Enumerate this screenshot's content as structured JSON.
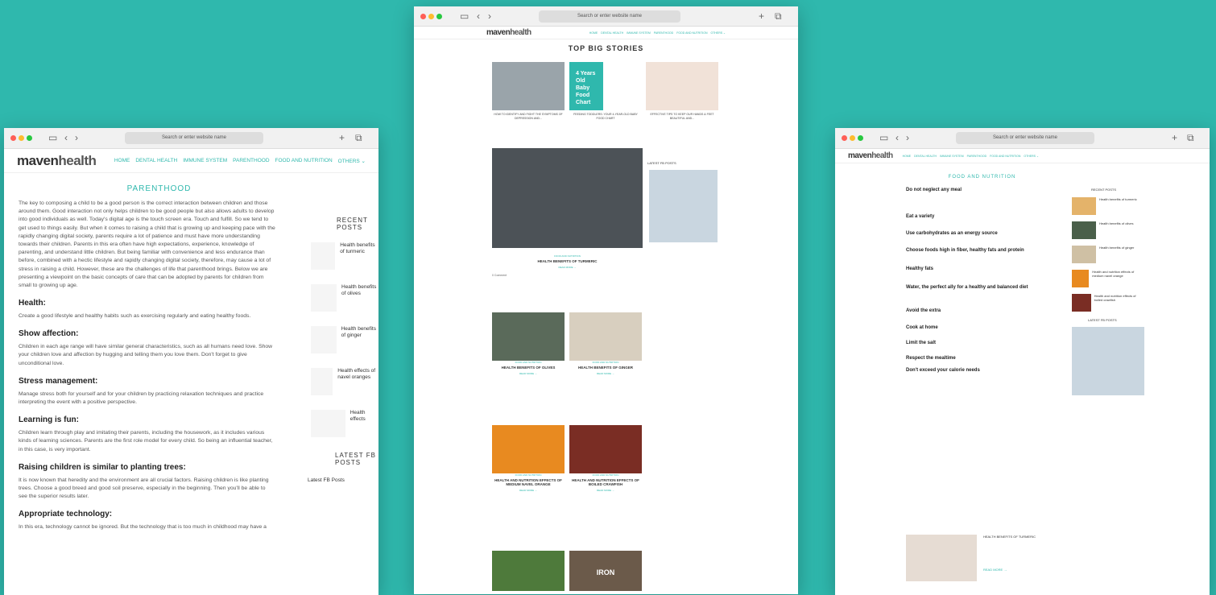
{
  "browser": {
    "address": "Search or enter website name"
  },
  "site": {
    "logo_a": "maven",
    "logo_b": "health",
    "menu": [
      "HOME",
      "DENTAL HEALTH",
      "IMMUNE SYSTEM",
      "PARENTHOOD",
      "FOOD AND NUTRITION",
      "OTHERS ⌄"
    ]
  },
  "left": {
    "section": "PARENTHOOD",
    "sidebar_title": "RECENT POSTS",
    "sidebar": [
      "Health benefits of turmeric",
      "Health benefits of olives",
      "Health benefits of ginger",
      "Health effects of navel oranges",
      "Health effects"
    ],
    "fb": "LATEST FB POSTS",
    "fb_link": "Latest FB Posts",
    "intro": "The key to composing a child to be a good person is the correct interaction between children and those around them. Good interaction not only helps children to be good people but also allows adults to develop into good individuals as well. Today's digital age is the touch screen era. Touch and fulfill. So we tend to get used to things easily. But when it comes to raising a child that is growing up and keeping pace with the rapidly changing digital society, parents require a lot of patience and must have more understanding towards their children. Parents in this era often have high expectations, experience, knowledge of parenting, and understand little children. But being familiar with convenience and less endurance than before, combined with a hectic lifestyle and rapidly changing digital society, therefore, may cause a lot of stress in raising a child. However, these are the challenges of life that parenthood brings. Below we are presenting a viewpoint on the basic concepts of care that can be adopted by parents for children from small to growing up age.",
    "sections": [
      {
        "h": "Health:",
        "t": "Create a good lifestyle and healthy habits such as exercising regularly and eating healthy foods."
      },
      {
        "h": "Show affection:",
        "t": "Children in each age range will have similar general characteristics, such as all humans need love. Show your children love and affection by hugging and telling them you love them. Don't forget to give unconditional love."
      },
      {
        "h": "Stress management:",
        "t": "Manage stress both for yourself and for your children by practicing relaxation techniques and practice interpreting the event with a positive perspective."
      },
      {
        "h": "Learning is fun:",
        "t": "Children learn through play and imitating their parents, including the housework, as it includes various kinds of learning sciences. Parents are the first role model for every child. So being an influential teacher, in this case, is very important."
      },
      {
        "h": "Raising children is similar to planting trees:",
        "t": "It is now known that heredity and the environment are all crucial factors. Raising children is like planting trees. Choose a good breed and good soil preserve, especially in the beginning. Then you'll be able to see the superior results later."
      },
      {
        "h": "Appropriate technology:",
        "t": "In this era, technology cannot be ignored. But the technology that is too much in childhood may have a"
      }
    ]
  },
  "center": {
    "title": "TOP BIG STORIES",
    "stories": [
      "HOW TO IDENTIFY AND FIGHT THE SYMPTOMS OF DEPRESSION AND...",
      "FEEDING TODDLERS: YOUR 4-YEAR-OLD BABY FOOD CHART",
      "EFFECTIVE TIPS TO KEEP OUR HANDS & FEET BEAUTIFUL AND..."
    ],
    "fb_title": "LATEST FB POSTS",
    "tag": "FOOD AND NUTRITION",
    "main_title": "HEALTH BENEFITS OF TURMERIC",
    "read": "READ MORE →",
    "comment": "0 Comment",
    "posts": [
      "HEALTH BENEFITS OF OLIVES",
      "HEALTH BENEFITS OF GINGER",
      "HEALTH AND NUTRITION EFFECTS OF MEDIUM NAVEL ORANGE",
      "HEALTH AND NUTRITION EFFECTS OF BOILED CRAWFISH"
    ],
    "iron": "IRON",
    "baby": "4 Years Old Baby Food Chart"
  },
  "right": {
    "section": "FOOD AND NUTRITION",
    "headings": [
      "Do not neglect any meal",
      "Eat a variety",
      "Use carbohydrates as an energy source",
      "Choose foods high in fiber, healthy fats and protein",
      "Healthy fats",
      "Water, the perfect ally for a healthy and balanced diet",
      "Avoid the extra",
      "Cook at home",
      "Limit the salt",
      "Respect the mealtime",
      "Don't exceed your calorie needs"
    ],
    "sidebar": [
      "Health benefits of turmeric",
      "Health benefits of olives",
      "Health benefits of ginger",
      "Health and nutrition effects of medium navel orange",
      "Health and nutrition effects of boiled crawfish"
    ],
    "recent": "RECENT POSTS",
    "fb": "LATEST FB POSTS",
    "bottom": "HEALTH BENEFITS OF TURMERIC",
    "read": "READ MORE →"
  }
}
